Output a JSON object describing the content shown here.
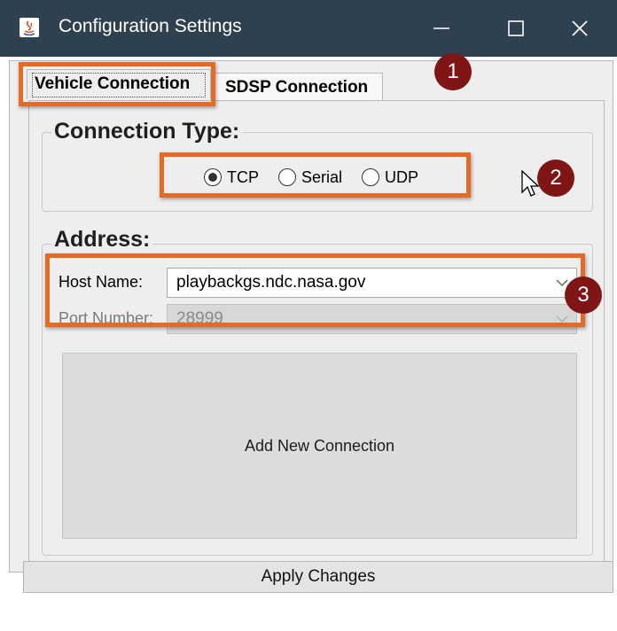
{
  "window": {
    "title": "Configuration Settings",
    "icon": "java-icon",
    "controls": [
      "minimize-icon",
      "maximize-icon",
      "close-icon"
    ]
  },
  "tabs": [
    {
      "label": "Vehicle Connection",
      "active": true
    },
    {
      "label": "SDSP Connection",
      "active": false
    }
  ],
  "connection_type": {
    "legend": "Connection Type:",
    "options": [
      {
        "label": "TCP",
        "selected": true
      },
      {
        "label": "Serial",
        "selected": false
      },
      {
        "label": "UDP",
        "selected": false
      }
    ]
  },
  "address": {
    "legend": "Address:",
    "host_label": "Host Name:",
    "host_value": "playbackgs.ndc.nasa.gov",
    "port_label": "Port Number:",
    "port_value": "28999"
  },
  "add_connection_label": "Add New Connection",
  "apply_label": "Apply Changes",
  "badges": [
    "1",
    "2",
    "3"
  ],
  "colors": {
    "titlebar": "#2f4151",
    "highlight": "#e46a25",
    "badge": "#7f1515"
  }
}
